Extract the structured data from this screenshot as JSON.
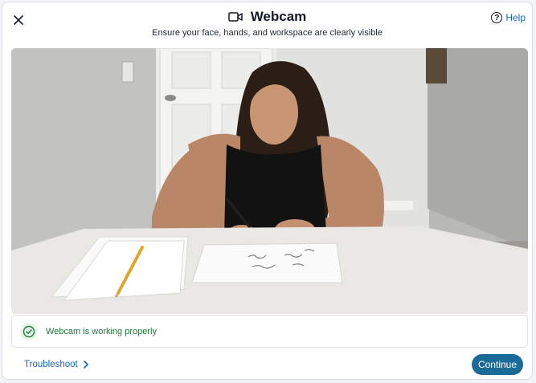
{
  "header": {
    "title": "Webcam",
    "subtitle": "Ensure your face, hands, and workspace are clearly visible",
    "help_label": "Help",
    "help_glyph": "?"
  },
  "icons": {
    "close": "close-icon",
    "camera": "video-camera-icon",
    "help": "help-circle-icon",
    "check": "check-circle-icon",
    "chevron": "chevron-right-icon"
  },
  "status": {
    "text": "Webcam is working properly",
    "color": "#1e7b3c"
  },
  "footer": {
    "troubleshoot_label": "Troubleshoot",
    "continue_label": "Continue"
  },
  "colors": {
    "link": "#1769c2",
    "primary_button": "#1b6b99",
    "success": "#1e7b3c"
  }
}
